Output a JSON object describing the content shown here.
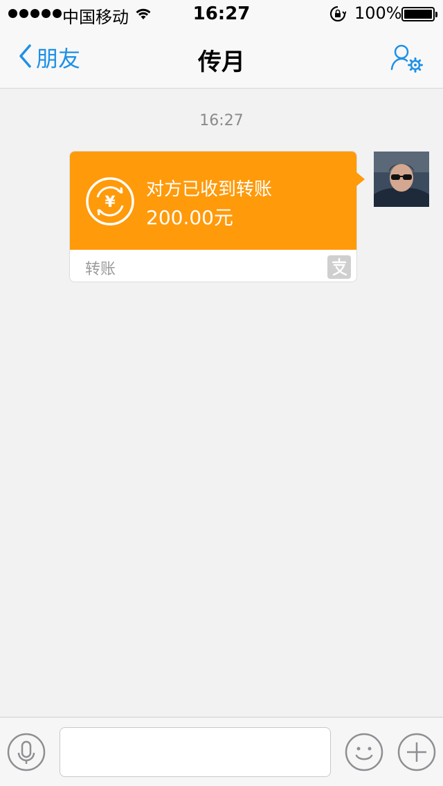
{
  "status_bar": {
    "carrier": "中国移动",
    "time": "16:27",
    "battery_percent": "100%",
    "signal_bars": 5
  },
  "nav": {
    "back_label": "朋友",
    "title": "传月",
    "profile_icon": "user-settings-icon",
    "accent_color": "#1e90e6"
  },
  "chat": {
    "timestamp": "16:27",
    "messages": [
      {
        "type": "transfer",
        "status": "对方已收到转账",
        "amount": "200.00元",
        "footer_label": "转账",
        "card_color": "#ff9a0a"
      }
    ]
  },
  "input_bar": {
    "text_value": "",
    "voice_icon": "microphone-icon",
    "emoji_icon": "smiley-icon",
    "plus_icon": "plus-icon"
  }
}
